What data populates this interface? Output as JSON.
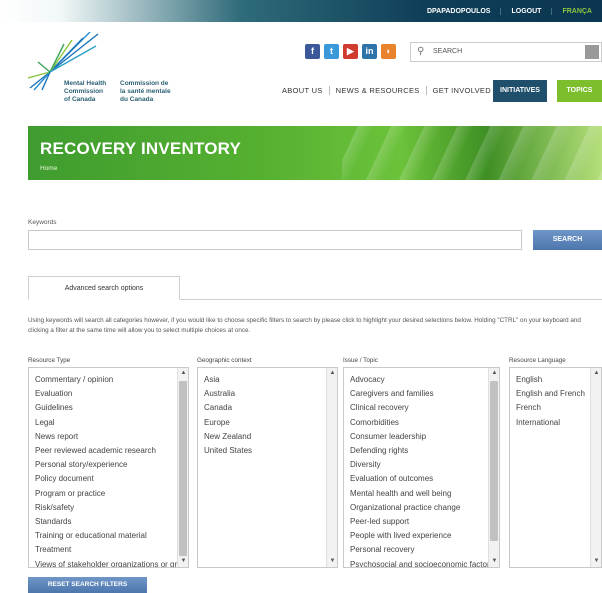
{
  "top_links": {
    "user": "DPAPADOPOULOS",
    "logout": "LOGOUT",
    "lang": "FRANÇA"
  },
  "logo": {
    "en": [
      "Mental Health",
      "Commission",
      "of Canada"
    ],
    "fr": [
      "Commission de",
      "la santé mentale",
      "du Canada"
    ]
  },
  "social": [
    {
      "icon": "facebook-icon",
      "glyph": "f",
      "color": "#3b5998"
    },
    {
      "icon": "twitter-icon",
      "glyph": "t",
      "color": "#3a9ad9"
    },
    {
      "icon": "youtube-icon",
      "glyph": "▶",
      "color": "#d03b2f"
    },
    {
      "icon": "linkedin-icon",
      "glyph": "in",
      "color": "#2f74a8"
    },
    {
      "icon": "rss-icon",
      "glyph": "◗",
      "color": "#e9822c"
    }
  ],
  "search_top": {
    "label": "SEARCH"
  },
  "nav": {
    "items": [
      "ABOUT US",
      "NEWS & RESOURCES",
      "GET INVOLVED"
    ],
    "initiatives": "INITIATIVES",
    "topics": "TOPICS"
  },
  "banner": {
    "title": "RECOVERY INVENTORY",
    "breadcrumb": "Home"
  },
  "keywords": {
    "label": "Keywords",
    "value": "",
    "search_button": "SEARCH"
  },
  "tabs": {
    "advanced": "Advanced search options"
  },
  "help_text": "Using keywords will search all categories however, if you would like to choose specific filters to search by please click to highlight your desired selections below. Holding \"CTRL\" on your keyboard and clicking a filter at the same time will allow you to select multiple choices at once.",
  "filters": {
    "resource_type": {
      "label": "Resource Type",
      "options": [
        "Commentary / opinion",
        "Evaluation",
        "Guidelines",
        "Legal",
        "News report",
        "Peer reviewed academic research",
        "Personal story/experience",
        "Policy document",
        "Program or practice",
        "Risk/safety",
        "Standards",
        "Training or educational material",
        "Treatment",
        "Views of stakeholder organizations or groups"
      ]
    },
    "geographic_context": {
      "label": "Geographic context",
      "options": [
        "Asia",
        "Australia",
        "Canada",
        "Europe",
        "New Zealand",
        "United States"
      ]
    },
    "issue_topic": {
      "label": "Issue / Topic",
      "options": [
        "Advocacy",
        "Caregivers and families",
        "Clinical recovery",
        "Comorbidities",
        "Consumer leadership",
        "Defending rights",
        "Diversity",
        "Evaluation of outcomes",
        "Mental health and well being",
        "Organizational practice change",
        "Peer-led support",
        "People with lived experience",
        "Personal recovery",
        "Psychosocial and socioeconomic factors"
      ]
    },
    "resource_language": {
      "label": "Resource Language",
      "options": [
        "English",
        "English and French",
        "French",
        "International"
      ]
    }
  },
  "reset_button": "RESET SEARCH FILTERS"
}
